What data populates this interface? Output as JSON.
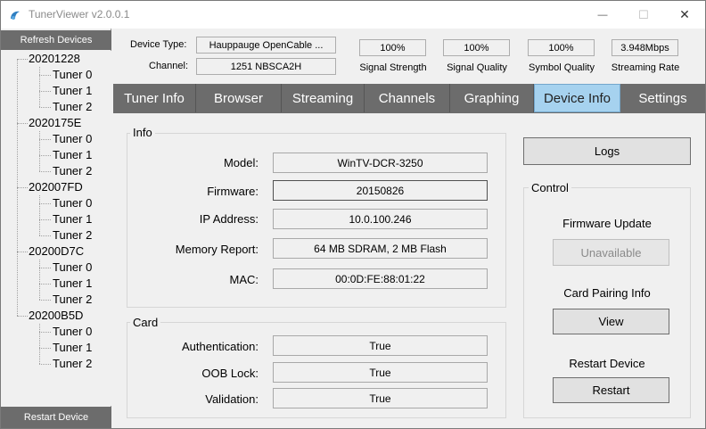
{
  "window": {
    "title": "TunerViewer v2.0.0.1",
    "minimize_glyph": "—",
    "maximize_glyph": "☐",
    "close_glyph": "✕"
  },
  "left": {
    "refresh_label": "Refresh Devices",
    "restart_label": "Restart Device",
    "devices": [
      {
        "name": "20201228",
        "tuners": [
          "Tuner 0",
          "Tuner 1",
          "Tuner 2"
        ]
      },
      {
        "name": "2020175E",
        "tuners": [
          "Tuner 0",
          "Tuner 1",
          "Tuner 2"
        ]
      },
      {
        "name": "202007FD",
        "tuners": [
          "Tuner 0",
          "Tuner 1",
          "Tuner 2"
        ]
      },
      {
        "name": "20200D7C",
        "tuners": [
          "Tuner 0",
          "Tuner 1",
          "Tuner 2"
        ]
      },
      {
        "name": "20200B5D",
        "tuners": [
          "Tuner 0",
          "Tuner 1",
          "Tuner 2"
        ]
      }
    ]
  },
  "header": {
    "device_type_label": "Device Type:",
    "device_type_value": "Hauppauge OpenCable ...",
    "channel_label": "Channel:",
    "channel_value": "1251 NBSCA2H",
    "meters": [
      {
        "value": "100%",
        "caption": "Signal Strength"
      },
      {
        "value": "100%",
        "caption": "Signal Quality"
      },
      {
        "value": "100%",
        "caption": "Symbol Quality"
      },
      {
        "value": "3.948Mbps",
        "caption": "Streaming Rate"
      }
    ]
  },
  "tabs": [
    "Tuner Info",
    "Browser",
    "Streaming",
    "Channels",
    "Graphing",
    "Device Info",
    "Settings"
  ],
  "active_tab": "Device Info",
  "info": {
    "title": "Info",
    "fields": [
      {
        "label": "Model:",
        "value": "WinTV-DCR-3250"
      },
      {
        "label": "Firmware:",
        "value": "20150826"
      },
      {
        "label": "IP Address:",
        "value": "10.0.100.246"
      },
      {
        "label": "Memory Report:",
        "value": "64 MB SDRAM, 2 MB Flash"
      },
      {
        "label": "MAC:",
        "value": "00:0D:FE:88:01:22"
      }
    ]
  },
  "card": {
    "title": "Card",
    "fields": [
      {
        "label": "Authentication:",
        "value": "True"
      },
      {
        "label": "OOB Lock:",
        "value": "True"
      },
      {
        "label": "Validation:",
        "value": "True"
      }
    ]
  },
  "logs_label": "Logs",
  "control": {
    "title": "Control",
    "firmware_update_label": "Firmware Update",
    "firmware_update_button": "Unavailable",
    "card_pairing_label": "Card Pairing Info",
    "card_pairing_button": "View",
    "restart_label": "Restart Device",
    "restart_button": "Restart"
  },
  "colors": {
    "tab_bar": "#6c6c6c",
    "active_tab": "#a6d2ef",
    "left_buttons": "#6c6c6c"
  }
}
